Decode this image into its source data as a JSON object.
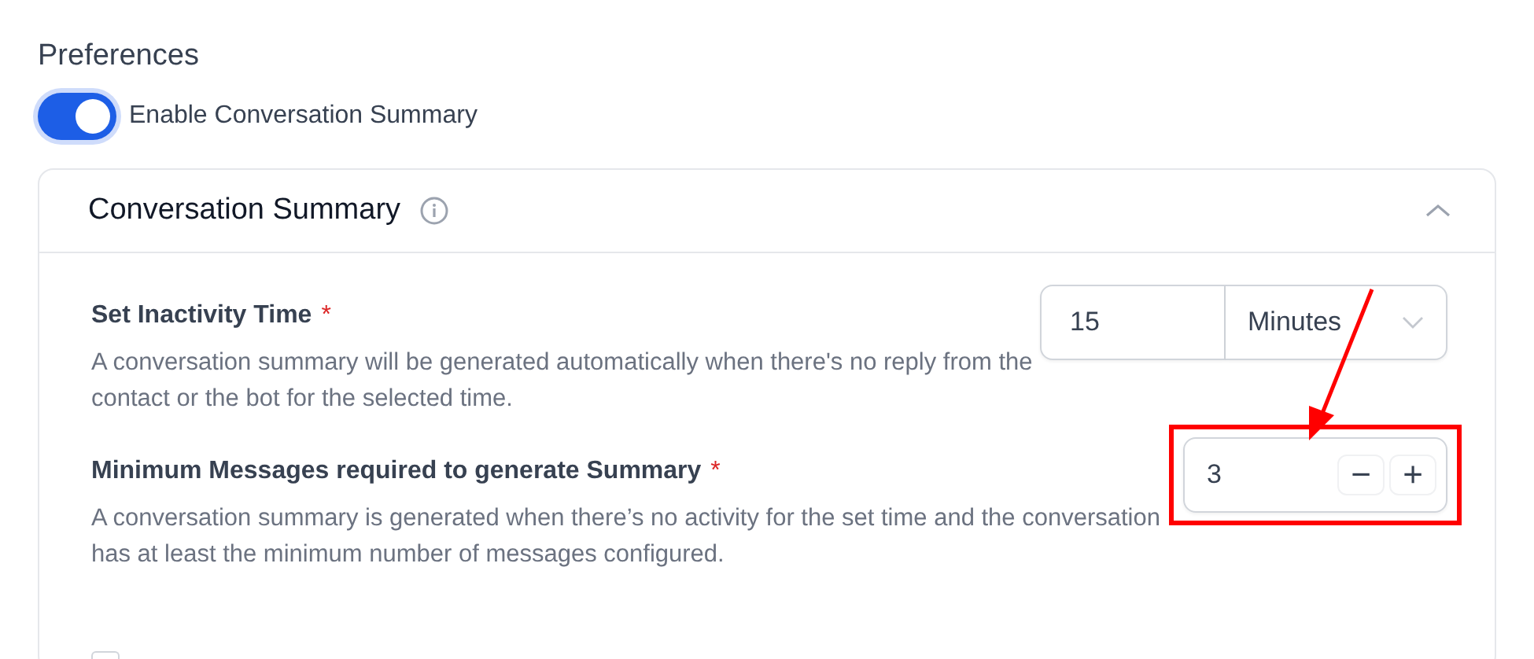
{
  "section_title": "Preferences",
  "toggle": {
    "label": "Enable Conversation Summary",
    "on": true
  },
  "panel": {
    "title": "Conversation Summary",
    "expanded": true,
    "settings": [
      {
        "kind": "duration",
        "label": "Set Inactivity Time",
        "required_mark": "*",
        "description": "A conversation summary will be generated automatically when there's no reply from the contact or the bot for the selected time.",
        "value": "15",
        "unit": "Minutes"
      },
      {
        "kind": "stepper",
        "label": "Minimum Messages required to generate Summary",
        "required_mark": "*",
        "description": "A conversation summary is generated when there’s no activity for the set time and the conversation has at least the minimum number of messages configured.",
        "value": "3",
        "minus": "−",
        "plus": "+",
        "highlighted": true
      }
    ]
  },
  "next_option": {
    "checked": false
  }
}
